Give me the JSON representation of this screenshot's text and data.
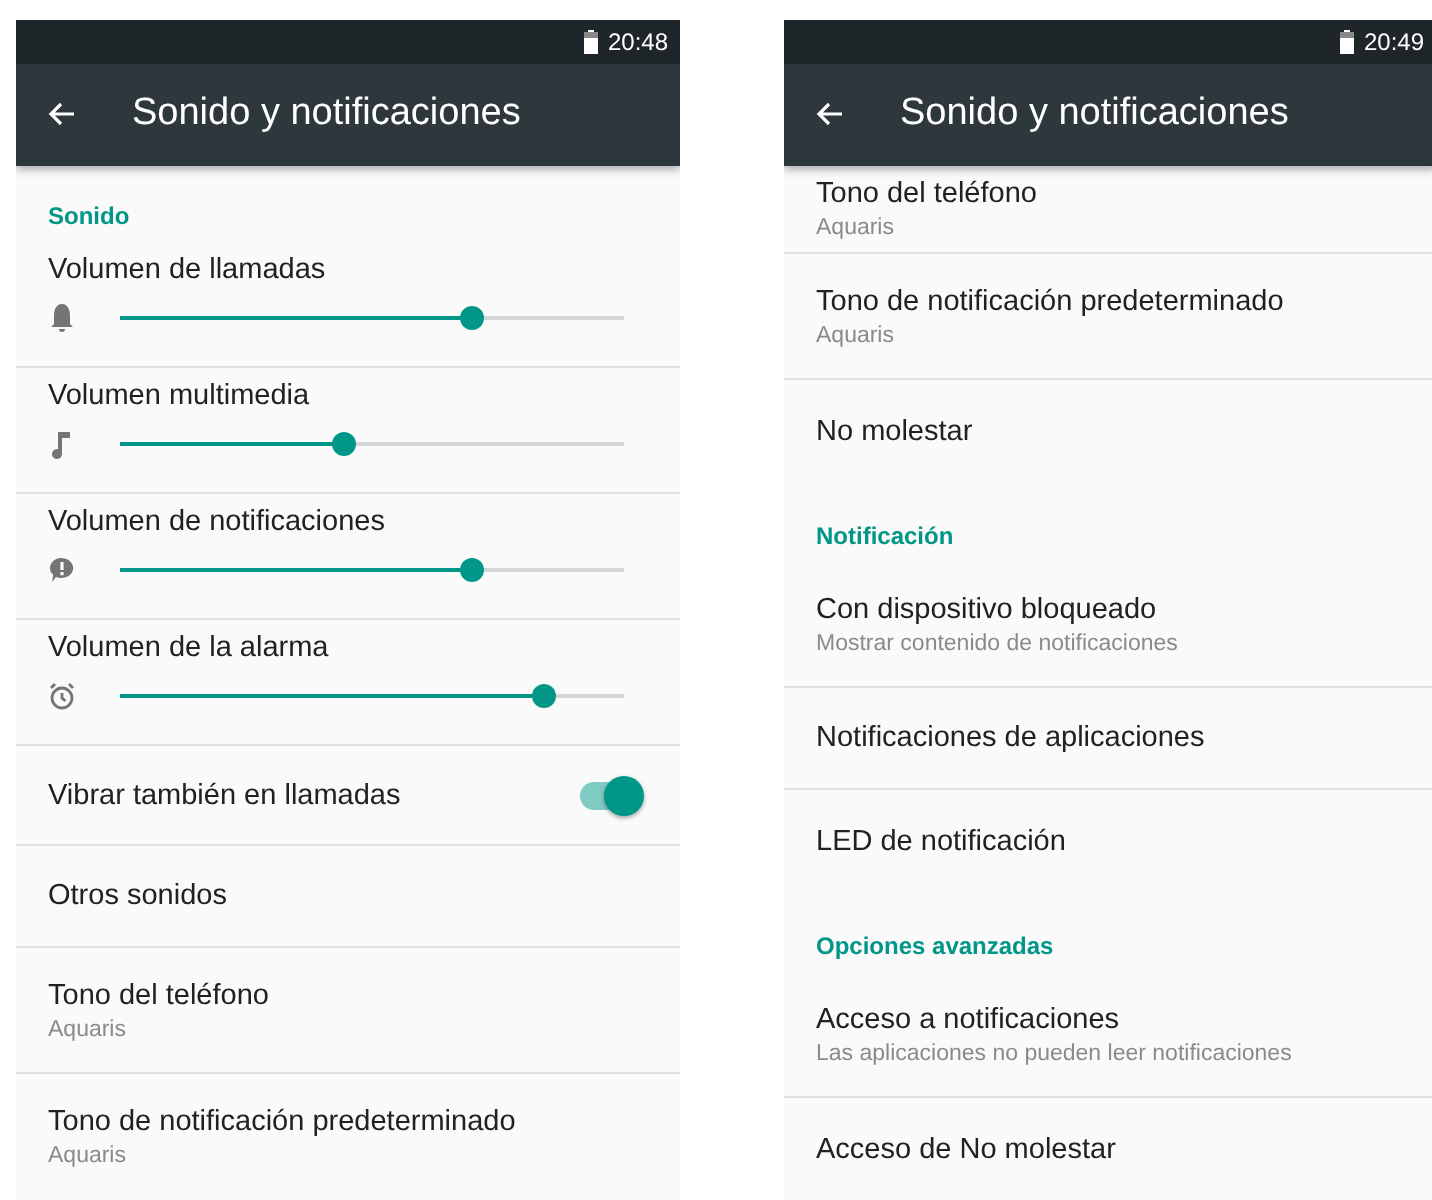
{
  "screens": [
    {
      "status_bar": {
        "time": "20:48"
      },
      "title": "Sonido y notificaciones",
      "items": [
        {
          "kind": "header",
          "title": "Sonido"
        },
        {
          "kind": "slider",
          "title": "Volumen de llamadas",
          "level": 0.71
        },
        {
          "kind": "slider",
          "title": "Volumen multimedia",
          "level": 0.44
        },
        {
          "kind": "slider",
          "title": "Volumen de notificaciones",
          "level": 0.71
        },
        {
          "kind": "slider",
          "title": "Volumen de la alarma",
          "level": 0.86
        },
        {
          "kind": "switch",
          "title": "Vibrar también en llamadas",
          "on": true
        },
        {
          "kind": "item",
          "title": "Otros sonidos"
        },
        {
          "kind": "item",
          "title": "Tono del teléfono",
          "subtitle": "Aquaris"
        },
        {
          "kind": "item",
          "title": "Tono de notificación predeterminado",
          "subtitle": "Aquaris"
        }
      ]
    },
    {
      "status_bar": {
        "time": "20:49"
      },
      "title": "Sonido y notificaciones",
      "items": [
        {
          "kind": "item",
          "title": "Tono del teléfono",
          "subtitle": "Aquaris"
        },
        {
          "kind": "item",
          "title": "Tono de notificación predeterminado",
          "subtitle": "Aquaris"
        },
        {
          "kind": "item",
          "title": "No molestar"
        },
        {
          "kind": "header",
          "title": "Notificación"
        },
        {
          "kind": "item",
          "title": "Con dispositivo bloqueado",
          "subtitle": "Mostrar contenido de notificaciones"
        },
        {
          "kind": "item",
          "title": "Notificaciones de aplicaciones"
        },
        {
          "kind": "item",
          "title": "LED de notificación"
        },
        {
          "kind": "header",
          "title": "Opciones avanzadas"
        },
        {
          "kind": "item",
          "title": "Acceso a notificaciones",
          "subtitle": "Las aplicaciones no pueden leer notificaciones"
        },
        {
          "kind": "item",
          "title": "Acceso de No molestar"
        }
      ]
    }
  ]
}
